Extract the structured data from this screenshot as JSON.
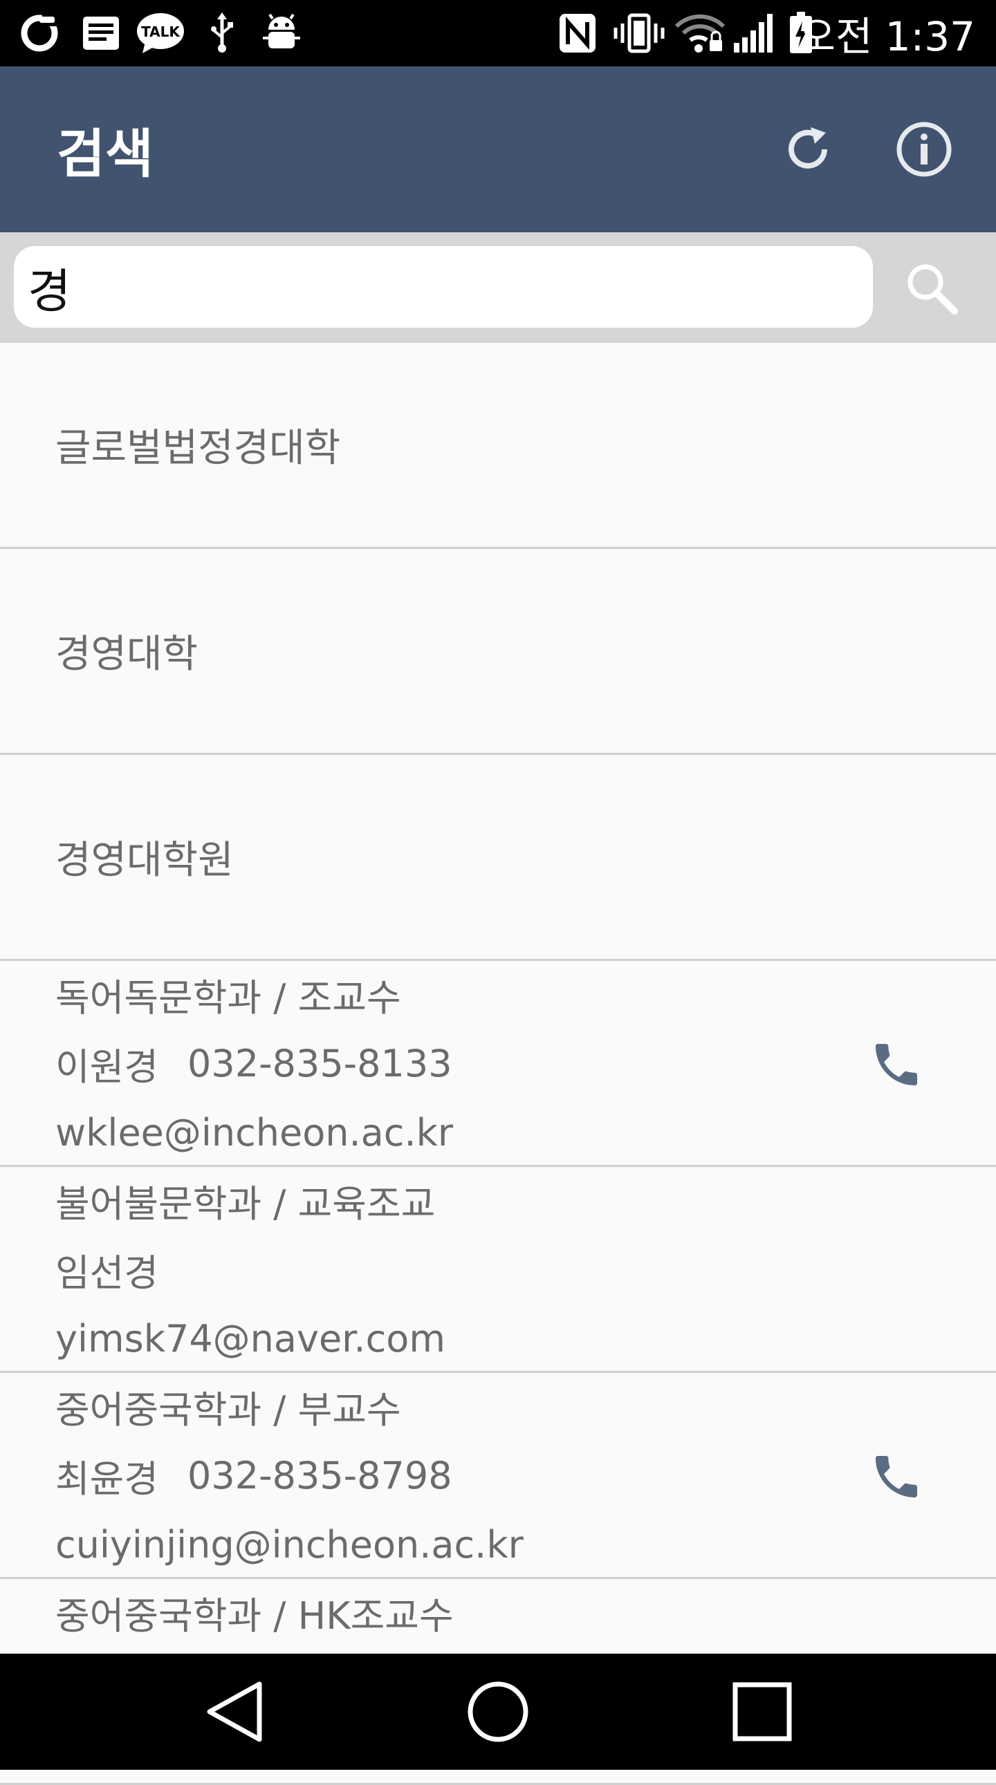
{
  "status_bar": {
    "time": "오전 1:37",
    "icons_left": [
      "notification-o-icon",
      "message-icon",
      "kakaotalk-icon",
      "usb-icon",
      "android-debug-icon"
    ],
    "icons_right": [
      "nfc-icon",
      "vibrate-icon",
      "wifi-icon",
      "signal-icon",
      "battery-icon"
    ],
    "talk_label": "TALK"
  },
  "app_bar": {
    "title": "검색",
    "bg_color": "#41536f",
    "actions": [
      "refresh-icon",
      "info-icon"
    ]
  },
  "search": {
    "value": "경",
    "button_icon": "search-icon"
  },
  "results": {
    "categories": [
      {
        "label": "글로벌법정경대학"
      },
      {
        "label": "경영대학"
      },
      {
        "label": "경영대학원"
      }
    ],
    "people": [
      {
        "dept": "독어독문학과 / 조교수",
        "name": "이원경",
        "phone": "032-835-8133",
        "email": "wklee@incheon.ac.kr",
        "has_call": true
      },
      {
        "dept": "불어불문학과 / 교육조교",
        "name": "임선경",
        "phone": "",
        "email": "yimsk74@naver.com",
        "has_call": false
      },
      {
        "dept": "중어중국학과 / 부교수",
        "name": "최윤경",
        "phone": "032-835-8798",
        "email": "cuiyinjing@incheon.ac.kr",
        "has_call": true
      },
      {
        "dept": "중어중국학과 / HK조교수"
      }
    ]
  },
  "nav_bar": {
    "buttons": [
      "back-icon",
      "home-icon",
      "recents-icon"
    ]
  }
}
